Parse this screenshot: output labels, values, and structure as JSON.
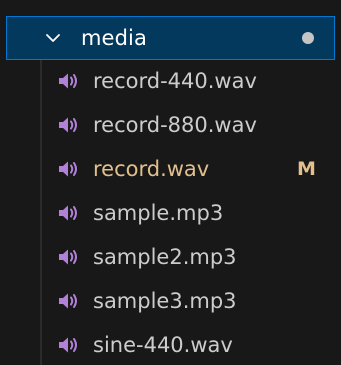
{
  "colors": {
    "selection_bg": "#04395e",
    "selection_border": "#0078d4",
    "modified_text": "#e2c08d",
    "default_text": "#cccccc",
    "audio_icon": "#b180d7",
    "dot": "#c5c5c5"
  },
  "folder": {
    "name": "media",
    "icon": "chevron-down-icon",
    "state": "expanded"
  },
  "files": [
    {
      "name": "record-440.wav",
      "icon": "audio-file-icon",
      "status": "",
      "modified": false
    },
    {
      "name": "record-880.wav",
      "icon": "audio-file-icon",
      "status": "",
      "modified": false
    },
    {
      "name": "record.wav",
      "icon": "audio-file-icon",
      "status": "M",
      "modified": true
    },
    {
      "name": "sample.mp3",
      "icon": "audio-file-icon",
      "status": "",
      "modified": false
    },
    {
      "name": "sample2.mp3",
      "icon": "audio-file-icon",
      "status": "",
      "modified": false
    },
    {
      "name": "sample3.mp3",
      "icon": "audio-file-icon",
      "status": "",
      "modified": false
    },
    {
      "name": "sine-440.wav",
      "icon": "audio-file-icon",
      "status": "",
      "modified": false
    }
  ]
}
